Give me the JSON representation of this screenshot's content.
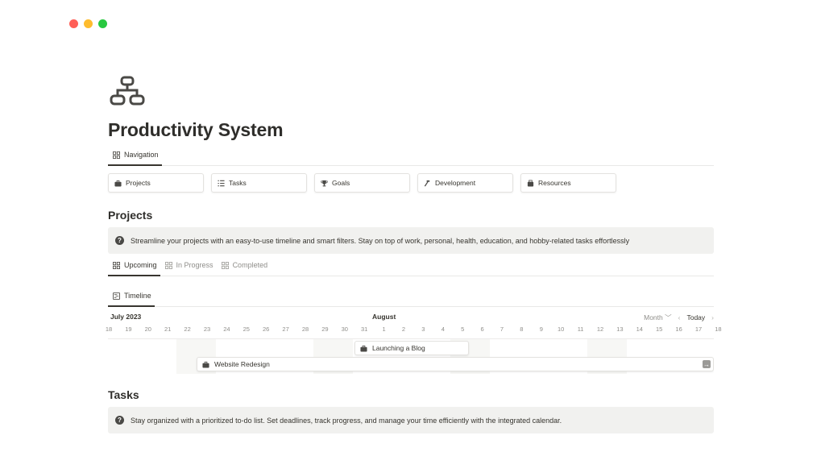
{
  "page": {
    "title": "Productivity System",
    "icon": "sitemap-icon"
  },
  "navigation_tab": {
    "label": "Navigation",
    "icon": "grid-icon"
  },
  "nav_buttons": [
    {
      "label": "Projects",
      "icon": "briefcase-icon"
    },
    {
      "label": "Tasks",
      "icon": "checklist-icon"
    },
    {
      "label": "Goals",
      "icon": "trophy-icon"
    },
    {
      "label": "Development",
      "icon": "hammer-icon"
    },
    {
      "label": "Resources",
      "icon": "archive-icon"
    }
  ],
  "projects": {
    "heading": "Projects",
    "callout": "Streamline your projects with an easy-to-use timeline and smart filters. Stay on top of work, personal, health, education, and hobby-related tasks effortlessly",
    "view_tabs": [
      {
        "label": "Upcoming",
        "active": true
      },
      {
        "label": "In Progress",
        "active": false
      },
      {
        "label": "Completed",
        "active": false
      }
    ],
    "sub_tab": "Timeline"
  },
  "timeline": {
    "month1": "July 2023",
    "month2": "August",
    "scale": "Month",
    "scale_chevron": "﹀",
    "prev": "‹",
    "today": "Today",
    "next": "›",
    "days": [
      "18",
      "19",
      "20",
      "21",
      "22",
      "23",
      "24",
      "25",
      "26",
      "27",
      "28",
      "29",
      "30",
      "31",
      "1",
      "2",
      "3",
      "4",
      "5",
      "6",
      "7",
      "8",
      "9",
      "10",
      "11",
      "12",
      "13",
      "14",
      "15",
      "16",
      "17",
      "18"
    ],
    "items": [
      {
        "label": "Launching a Blog",
        "icon": "briefcase-icon"
      },
      {
        "label": "Website Redesign",
        "icon": "briefcase-icon",
        "continues": true,
        "continue_icon": "arrow-right-icon",
        "continue_symbol": "→"
      }
    ]
  },
  "tasks": {
    "heading": "Tasks",
    "callout": "Stay organized with a prioritized to-do list. Set deadlines, track progress, and manage your time efficiently with the integrated calendar."
  },
  "colors": {
    "close": "#ff5f57",
    "minimize": "#febc2e",
    "maximize": "#28c840",
    "text": "#37352f",
    "callout_bg": "#f1f1ef"
  }
}
